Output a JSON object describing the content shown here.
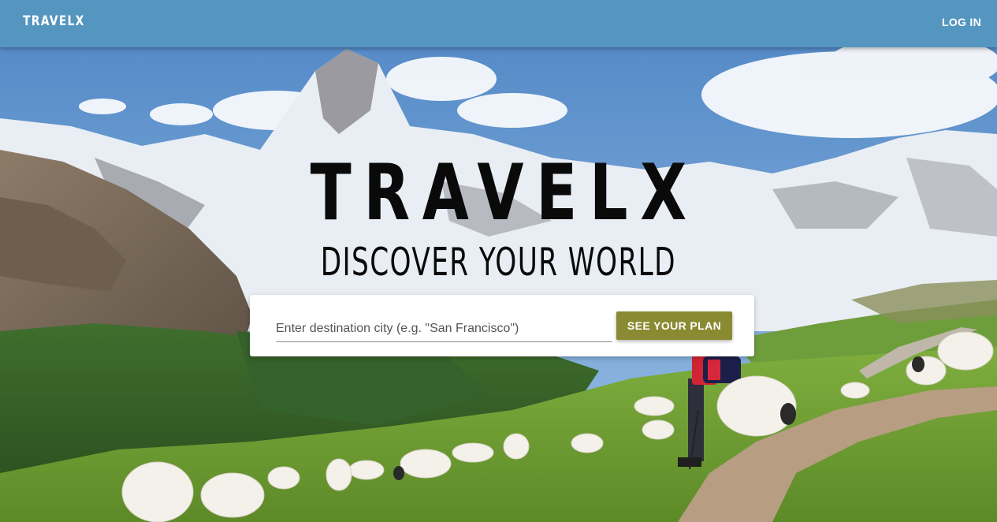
{
  "navbar": {
    "brand": "TRAVELX",
    "login_label": "LOG IN",
    "background_color": "#5596c0"
  },
  "hero": {
    "title": "TRAVELX",
    "subtitle": "DISCOVER YOUR WORLD",
    "background_image": "alpine-mountain-meadow-with-hiker-and-sheep"
  },
  "search": {
    "placeholder": "Enter destination city (e.g. \"San Francisco\")",
    "value": "",
    "button_label": "SEE YOUR PLAN",
    "button_color": "#8a8a32"
  }
}
